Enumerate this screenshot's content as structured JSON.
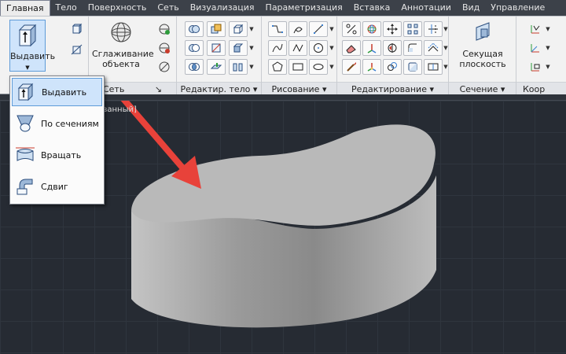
{
  "tabs": [
    "Главная",
    "Тело",
    "Поверхность",
    "Сеть",
    "Визуализация",
    "Параметризация",
    "Вставка",
    "Аннотации",
    "Вид",
    "Управление"
  ],
  "ribbon": {
    "extrude_label": "Выдавить",
    "smooth_label_1": "Сглаживание",
    "smooth_label_2": "объекта",
    "section_plane_label_1": "Секущая",
    "section_plane_label_2": "плоскость",
    "panels": {
      "mesh": "Сеть",
      "solid_edit": "Редактир. тело",
      "draw": "Рисование",
      "modify": "Редактирование",
      "section": "Сечение",
      "coords": "Коор"
    },
    "panel_arrows": {
      "mesh": "↘",
      "solid_edit": "▾",
      "draw": "▾",
      "modify": "▾",
      "section": "▾"
    }
  },
  "viewport": {
    "label_partial": "рованный]"
  },
  "dropdown": {
    "items": [
      {
        "label": "Выдавить",
        "icon": "extrude-icon",
        "selected": true
      },
      {
        "label": "По сечениям",
        "icon": "loft-icon",
        "selected": false
      },
      {
        "label": "Вращать",
        "icon": "revolve-icon",
        "selected": false
      },
      {
        "label": "Сдвиг",
        "icon": "sweep-icon",
        "selected": false
      }
    ]
  },
  "colors": {
    "arrow": "#e8423a",
    "ribbon_bg": "#f2f2f2",
    "viewport_bg": "#262b33",
    "selection": "#cfe4fb",
    "solid": "#b9b9b9"
  }
}
